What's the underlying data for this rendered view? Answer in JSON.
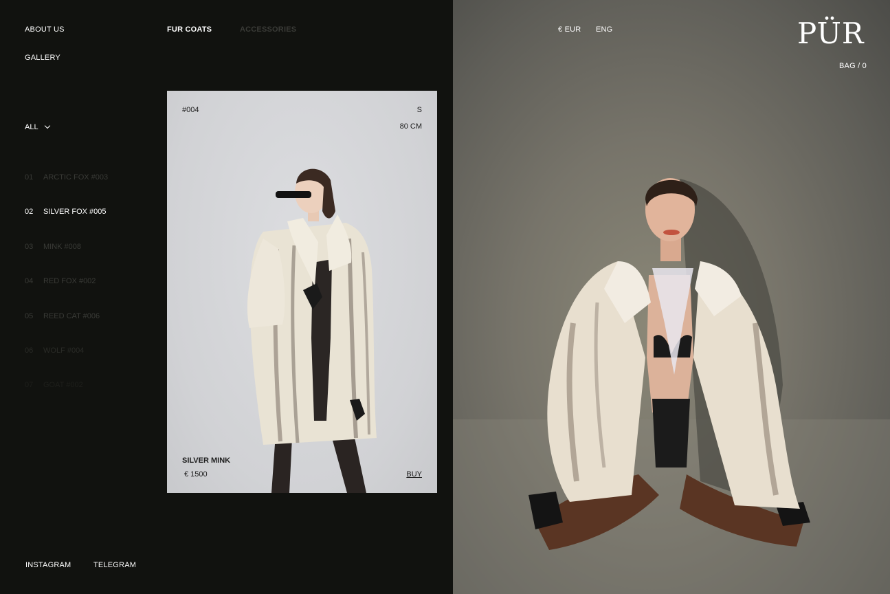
{
  "nav": {
    "about": "ABOUT US",
    "gallery": "GALLERY",
    "fur_coats": "FUR COATS",
    "accessories": "ACCESSORIES",
    "currency": "€ EUR",
    "language": "ENG",
    "bag": "BAG / 0"
  },
  "brand": {
    "logo": "PÜR"
  },
  "filter": {
    "label": "ALL",
    "icon": "chevron-down-icon"
  },
  "products": [
    {
      "num": "01",
      "name": "ARCTIC FOX #003"
    },
    {
      "num": "02",
      "name": "SILVER FOX #005"
    },
    {
      "num": "03",
      "name": "MINK #008"
    },
    {
      "num": "04",
      "name": "RED FOX #002"
    },
    {
      "num": "05",
      "name": "REED CAT #006"
    },
    {
      "num": "06",
      "name": "WOLF #004"
    },
    {
      "num": "07",
      "name": "GOAT #002"
    }
  ],
  "card": {
    "sku": "#004",
    "size": "S",
    "length": "80 CM",
    "name": "SILVER MINK",
    "price": "€ 1500",
    "buy": "BUY"
  },
  "footer": {
    "instagram": "INSTAGRAM",
    "telegram": "TELEGRAM"
  },
  "colors": {
    "background": "#11120f",
    "muted_text": "#3a3b37",
    "card_bg": "#d6d7d9",
    "hero_bg": "#77746a"
  }
}
